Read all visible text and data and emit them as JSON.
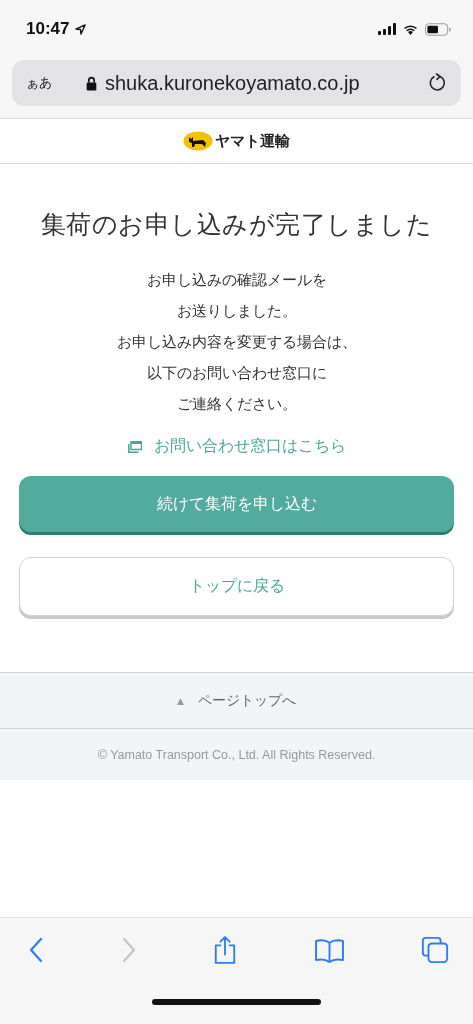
{
  "status_bar": {
    "time": "10:47"
  },
  "address_bar": {
    "text_size_button": "ぁあ",
    "url": "shuka.kuronekoyamato.co.jp"
  },
  "header": {
    "logo_text": "ヤマト運輸"
  },
  "title": "集荷のお申し込みが完了しました",
  "message_lines": [
    "お申し込みの確認メールを",
    "お送りしました。",
    "お申し込み内容を変更する場合は、",
    "以下のお問い合わせ窓口に",
    "ご連絡ください。"
  ],
  "contact_link": "お問い合わせ窓口はこちら",
  "buttons": [
    {
      "kind": "primary",
      "label": "続けて集荷を申し込む"
    },
    {
      "kind": "secondary",
      "label": "トップに戻る"
    }
  ],
  "page_top": {
    "icon": "▲",
    "label": "ページトップへ"
  },
  "copyright": "© Yamato Transport Co., Ltd. All Rights Reserved.",
  "toolbar": [
    {
      "kind": "back",
      "disabled": false
    },
    {
      "kind": "forward",
      "disabled": true
    },
    {
      "kind": "share",
      "disabled": false
    },
    {
      "kind": "bookmarks",
      "disabled": false
    },
    {
      "kind": "tabs",
      "disabled": false
    }
  ]
}
